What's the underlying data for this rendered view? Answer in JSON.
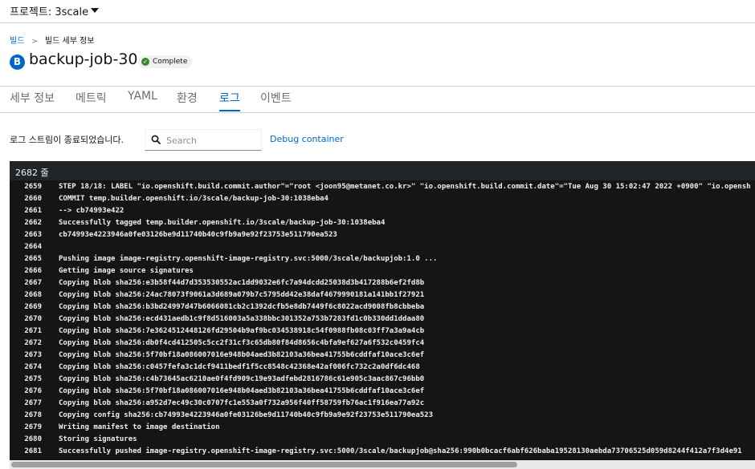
{
  "project_bar": {
    "label": "프로젝트: 3scale"
  },
  "breadcrumb": {
    "parent": "빌드",
    "current": "빌드 세부 정보"
  },
  "header": {
    "badge": "B",
    "title": "backup-job-30",
    "status": "Complete",
    "status_color": "#3e8635"
  },
  "tabs": [
    {
      "label": "세부 정보",
      "active": false
    },
    {
      "label": "메트릭",
      "active": false
    },
    {
      "label": "YAML",
      "active": false
    },
    {
      "label": "환경",
      "active": false
    },
    {
      "label": "로그",
      "active": true
    },
    {
      "label": "이벤트",
      "active": false
    }
  ],
  "log_toolbar": {
    "message": "로그 스트림이 종료되었습니다.",
    "search_placeholder": "Search",
    "debug_label": "Debug container"
  },
  "log": {
    "line_count": "2682 줄",
    "lines": [
      {
        "num": "2659",
        "text": "STEP 18/18: LABEL \"io.openshift.build.commit.author\"=\"root <joon95@metanet.co.kr>\" \"io.openshift.build.commit.date\"=\"Tue Aug 30 15:02:47 2022 +0900\" \"io.opensh"
      },
      {
        "num": "2660",
        "text": "COMMIT temp.builder.openshift.io/3scale/backup-job-30:1038eba4"
      },
      {
        "num": "2661",
        "text": "--> cb74993e422"
      },
      {
        "num": "2662",
        "text": "Successfully tagged temp.builder.openshift.io/3scale/backup-job-30:1038eba4"
      },
      {
        "num": "2663",
        "text": "cb74993e4223946a0fe03126be9d11740b40c9fb9a9e92f23753e511790ea523"
      },
      {
        "num": "2664",
        "text": ""
      },
      {
        "num": "2665",
        "text": "Pushing image image-registry.openshift-image-registry.svc:5000/3scale/backupjob:1.0 ..."
      },
      {
        "num": "2666",
        "text": "Getting image source signatures"
      },
      {
        "num": "2667",
        "text": "Copying blob sha256:e3b58f44d7d353530552ac1dd9032e6fc7a94dcdd25038d3b417288b6ef2fd8b"
      },
      {
        "num": "2668",
        "text": "Copying blob sha256:24ac78073f9061a3d689a079b7c5795dd42e38daf4679990181a141bb1f27921"
      },
      {
        "num": "2669",
        "text": "Copying blob sha256:b3bd24997d47b6066081cb2c1392dcfb5e8db7449f6c8022acd9008fb8cbbeba"
      },
      {
        "num": "2670",
        "text": "Copying blob sha256:ecd431aedb1c9f8d516003a5a338bbc301352a753b7283fd1c0b330dd1ddaa80"
      },
      {
        "num": "2671",
        "text": "Copying blob sha256:7e3624512448126fd29504b9af9bc034538918c54f0988fb08c03ff7a3a9a4cb"
      },
      {
        "num": "2672",
        "text": "Copying blob sha256:db0f4cd412505c5cc2f31cf3c65db80f84d8656c4bfa9ef627a6f532c0459fc4"
      },
      {
        "num": "2673",
        "text": "Copying blob sha256:5f70bf18a086007016e948b04aed3b82103a36bea41755b6cddfaf10ace3c6ef"
      },
      {
        "num": "2674",
        "text": "Copying blob sha256:c0457fefa3c1dcf9411bedf1f5cc8548c42368e42af006fc732c2a0df6dc468"
      },
      {
        "num": "2675",
        "text": "Copying blob sha256:c4b73645ac6210ae0f4fd909c19e93adfebd2816786c61e905c3aac867c96bb0"
      },
      {
        "num": "2676",
        "text": "Copying blob sha256:5f70bf18a086007016e948b04aed3b82103a36bea41755b6cddfaf10ace3c6ef"
      },
      {
        "num": "2677",
        "text": "Copying blob sha256:a952d7ec49c30c0707fc1e553a0f732a956f40ff58759fb76ac1f916ea77a92c"
      },
      {
        "num": "2678",
        "text": "Copying config sha256:cb74993e4223946a0fe03126be9d11740b40c9fb9a9e92f23753e511790ea523"
      },
      {
        "num": "2679",
        "text": "Writing manifest to image destination"
      },
      {
        "num": "2680",
        "text": "Storing signatures"
      },
      {
        "num": "2681",
        "text": "Successfully pushed image-registry.openshift-image-registry.svc:5000/3scale/backupjob@sha256:990b0bcacf6abf626baba19528130aebda73706525d059d8244f412a7f3d4e91"
      }
    ]
  }
}
